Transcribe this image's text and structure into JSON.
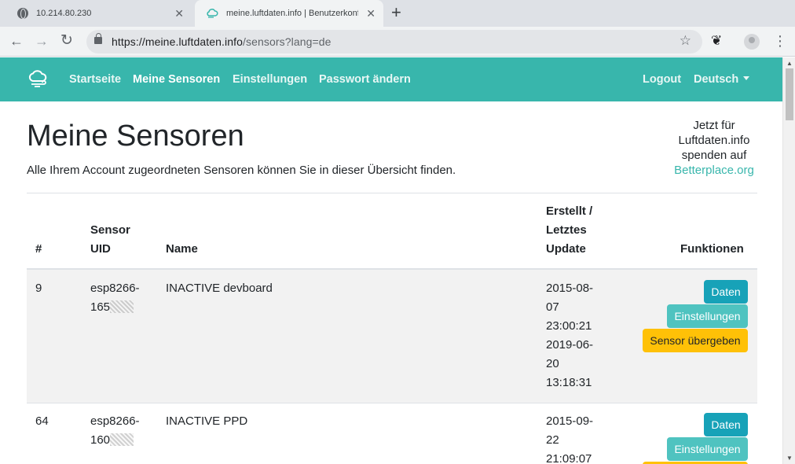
{
  "browser": {
    "tabs": [
      {
        "title": "10.214.80.230",
        "icon": "globe-icon"
      },
      {
        "title": "meine.luftdaten.info | Benutzerkonf",
        "icon": "cloud-icon"
      }
    ],
    "close_glyph": "✕",
    "new_tab_glyph": "+",
    "url_host": "https://meine.luftdaten.info",
    "url_path": "/sensors?lang=de"
  },
  "nav": {
    "links": [
      "Startseite",
      "Meine Sensoren",
      "Einstellungen",
      "Passwort ändern"
    ],
    "logout": "Logout",
    "language": "Deutsch"
  },
  "page": {
    "title": "Meine Sensoren",
    "lead": "Alle Ihrem Account zugeordneten Sensoren können Sie in dieser Übersicht finden."
  },
  "donate": {
    "line1": "Jetzt für",
    "line2": "Luftdaten.info",
    "line3": "spenden auf",
    "link": "Betterplace.org"
  },
  "table": {
    "headers": {
      "num": "#",
      "uid_1": "Sensor",
      "uid_2": "UID",
      "name": "Name",
      "date_1": "Erstellt /",
      "date_2": "Letztes",
      "date_3": "Update",
      "functions": "Funktionen"
    },
    "rows": [
      {
        "num": "9",
        "uid_1": "esp8266-",
        "uid_2": "165",
        "name": "INACTIVE devboard",
        "created_1": "2015-08-",
        "created_2": "07",
        "created_3": "23:00:21",
        "updated_1": "2019-06-",
        "updated_2": "20",
        "updated_3": "13:18:31"
      },
      {
        "num": "64",
        "uid_1": "esp8266-",
        "uid_2": "160",
        "name": "INACTIVE PPD",
        "created_1": "2015-09-",
        "created_2": "22",
        "created_3": "21:09:07"
      }
    ],
    "buttons": {
      "data": "Daten",
      "settings": "Einstellungen",
      "transfer": "Sensor übergeben"
    }
  },
  "colors": {
    "navbar": "#38b6ac",
    "btn_data": "#17a2b8",
    "btn_settings": "#4fc3c0",
    "btn_transfer": "#ffc107"
  }
}
